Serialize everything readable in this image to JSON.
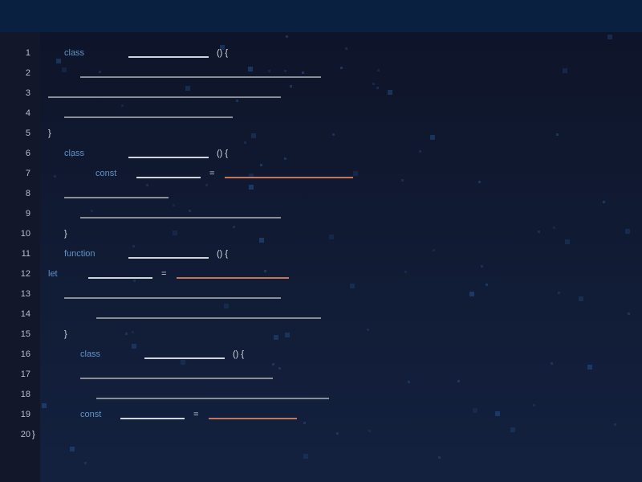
{
  "editor": {
    "colors": {
      "background": "#0e1428",
      "topbar": "#0a2040",
      "gutter": "#121829",
      "keyword": "#5f92c6",
      "line_number": "#b8bfcf",
      "identifier": "#d0d4dc",
      "statement": "#8a8e97",
      "string": "#c4765a"
    },
    "lines": [
      {
        "num": "1",
        "keyword": "class",
        "punct": "() {"
      },
      {
        "num": "2",
        "keyword": "",
        "punct": ""
      },
      {
        "num": "3",
        "keyword": "",
        "punct": ""
      },
      {
        "num": "4",
        "keyword": "",
        "punct": ""
      },
      {
        "num": "5",
        "keyword": "",
        "punct": "}"
      },
      {
        "num": "6",
        "keyword": "class",
        "punct": "() {"
      },
      {
        "num": "7",
        "keyword": "const",
        "punct": "="
      },
      {
        "num": "8",
        "keyword": "",
        "punct": ""
      },
      {
        "num": "9",
        "keyword": "",
        "punct": ""
      },
      {
        "num": "10",
        "keyword": "",
        "punct": "}"
      },
      {
        "num": "11",
        "keyword": "function",
        "punct": "() {"
      },
      {
        "num": "12",
        "keyword": "let",
        "punct": "="
      },
      {
        "num": "13",
        "keyword": "",
        "punct": ""
      },
      {
        "num": "14",
        "keyword": "",
        "punct": ""
      },
      {
        "num": "15",
        "keyword": "",
        "punct": "}"
      },
      {
        "num": "16",
        "keyword": "class",
        "punct": "() {"
      },
      {
        "num": "17",
        "keyword": "",
        "punct": ""
      },
      {
        "num": "18",
        "keyword": "",
        "punct": ""
      },
      {
        "num": "19",
        "keyword": "const",
        "punct": "="
      },
      {
        "num": "20",
        "keyword": "",
        "punct": "}"
      }
    ]
  }
}
